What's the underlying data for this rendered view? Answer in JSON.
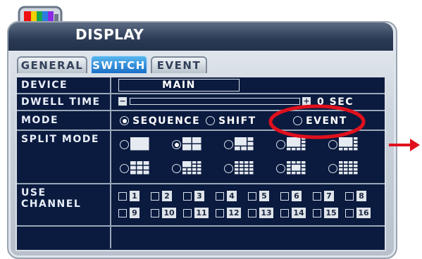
{
  "window": {
    "title": "DISPLAY"
  },
  "tabs": [
    {
      "label": "GENERAL",
      "active": false
    },
    {
      "label": "SWITCH",
      "active": true
    },
    {
      "label": "EVENT",
      "active": false
    }
  ],
  "rows": {
    "device": {
      "label": "DEVICE",
      "value": "MAIN"
    },
    "dwell_time": {
      "label": "DWELL TIME",
      "value_text": "0 SEC",
      "slider_value": 0,
      "minus": "−",
      "plus": "+"
    },
    "mode": {
      "label": "MODE",
      "options": [
        {
          "label": "SEQUENCE",
          "selected": true
        },
        {
          "label": "SHIFT",
          "selected": false
        },
        {
          "label": "EVENT",
          "selected": false
        }
      ]
    },
    "split_mode": {
      "label": "SPLIT MODE",
      "selected_index": 1
    },
    "use_channel": {
      "label": "USE CHANNEL",
      "channels": [
        "1",
        "2",
        "3",
        "4",
        "5",
        "6",
        "7",
        "8",
        "9",
        "10",
        "11",
        "12",
        "13",
        "14",
        "15",
        "16"
      ]
    }
  },
  "annotation": {
    "highlight_color": "#e0101c",
    "arrow_color": "#e0101c"
  },
  "colors": {
    "panel_bg": "#0b1b3f",
    "tab_active": "#1a6fc6"
  }
}
